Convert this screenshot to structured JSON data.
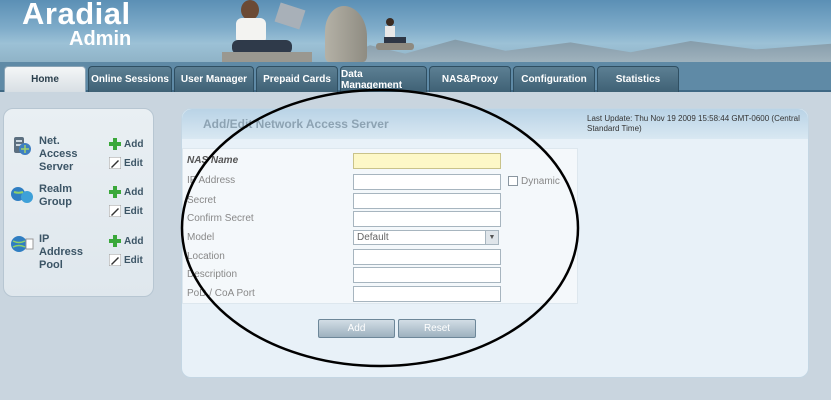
{
  "header": {
    "logo_main": "Aradial",
    "logo_sub": "Admin"
  },
  "nav": {
    "tabs": [
      {
        "label": "Home",
        "active": true
      },
      {
        "label": "Online Sessions"
      },
      {
        "label": "User Manager"
      },
      {
        "label": "Prepaid Cards"
      },
      {
        "label": "Data Management"
      },
      {
        "label": "NAS&Proxy"
      },
      {
        "label": "Configuration"
      },
      {
        "label": "Statistics"
      }
    ]
  },
  "sidebar": {
    "items": [
      {
        "label": "Net. Access Server",
        "add": "Add",
        "edit": "Edit"
      },
      {
        "label": "Realm Group",
        "add": "Add",
        "edit": "Edit"
      },
      {
        "label": "IP Address Pool",
        "add": "Add",
        "edit": "Edit"
      }
    ]
  },
  "main": {
    "title": "Add/Edit Network Access Server",
    "last_update": "Last Update: Thu Nov 19 2009 15:58:44 GMT-0600 (Central Standard Time)",
    "fields": {
      "nas_name": "NAS Name",
      "ip_address": "IP Address",
      "dynamic": "Dynamic",
      "secret": "Secret",
      "confirm_secret": "Confirm Secret",
      "model": "Model",
      "model_value": "Default",
      "location": "Location",
      "description": "Description",
      "pod_port": "PoD / CoA Port"
    },
    "buttons": {
      "add": "Add",
      "reset": "Reset"
    }
  },
  "colors": {
    "nav_bg": "#5f8aa6",
    "accent": "#3f6175",
    "highlight_field": "#fdf8c7"
  }
}
